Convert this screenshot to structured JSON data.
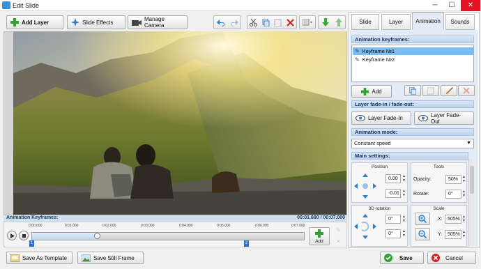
{
  "window": {
    "title": "Edit Slide"
  },
  "toolbar": {
    "add_layer": "Add Layer",
    "slide_effects": "Slide Effects",
    "manage_camera": "Manage Camera"
  },
  "timeline": {
    "title": "Animation Keyframes:",
    "time": "00:01.680 / 00:07.000",
    "ticks": [
      "0:00.000",
      "0:01.000",
      "0:02.000",
      "0:03.000",
      "0:04.000",
      "0:05.000",
      "0:06.000",
      "0:07.000"
    ],
    "markers": [
      "1",
      "2"
    ],
    "add_label": "Add",
    "progress": 0.24
  },
  "bottom": {
    "save_template": "Save As Template",
    "save_still": "Save Still Frame",
    "save": "Save",
    "cancel": "Cancel"
  },
  "tabs": [
    "Slide",
    "Layer",
    "Animation",
    "Sounds"
  ],
  "active_tab": "Animation",
  "panel": {
    "kf_header": "Animation keyframes:",
    "keyframes": [
      "Keyframe №1",
      "Keyframe №2"
    ],
    "add_label": "Add",
    "fade_header": "Layer fade-in / fade-out:",
    "fade_in": "Layer Fade-In",
    "fade_out": "Layer Fade-Out",
    "mode_header": "Animation mode:",
    "mode_value": "Constant speed",
    "main_header": "Main settings:",
    "position_label": "Position",
    "pos_x": "0.00",
    "pos_y": "-0.01",
    "tools_label": "Tools",
    "opacity_label": "Opacity:",
    "opacity_value": "50%",
    "rotate_label": "Rotate:",
    "rotate_value": "0°",
    "rotation3d_label": "3D rotation",
    "rot3d_a": "0°",
    "rot3d_b": "0°",
    "scale_label": "Scale",
    "scale_x_label": "X:",
    "scale_x": "505%",
    "scale_y_label": "Y:",
    "scale_y": "505%"
  },
  "colors": {
    "accent": "#7cbdf1",
    "section": "#bdd3ec",
    "add_green": "#2fa32f"
  }
}
